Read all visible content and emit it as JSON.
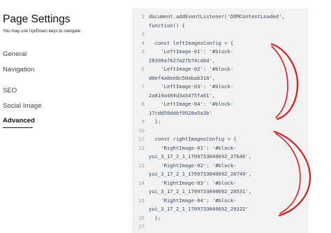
{
  "sidebar": {
    "title": "Page Settings",
    "hint": "You may use Up/Down keys to navigate",
    "items": [
      {
        "label": "General",
        "active": false
      },
      {
        "label": "Navigation",
        "active": false
      },
      {
        "label": "SEO",
        "active": false
      },
      {
        "label": "Social Image",
        "active": false
      },
      {
        "label": "Advanced",
        "active": true
      }
    ]
  },
  "editor": {
    "lines": [
      {
        "n": "2",
        "text": "document.addEventListener('DOMContentLoaded',"
      },
      {
        "n": "",
        "text": "function() {"
      },
      {
        "n": "3",
        "text": ""
      },
      {
        "n": "4",
        "text": "  const leftImagesConfig = {"
      },
      {
        "n": "5",
        "text": "    'LeftImage-01': '#block-"
      },
      {
        "n": "",
        "text": "28399af627a27b74cd0d',"
      },
      {
        "n": "6",
        "text": "    'LeftImage-02': '#block-"
      },
      {
        "n": "",
        "text": "d0ef4a0ee8c50ebab310',"
      },
      {
        "n": "7",
        "text": "    'LeftImage-03': '#block-"
      },
      {
        "n": "",
        "text": "2a819a494d3a5475fa01',"
      },
      {
        "n": "8",
        "text": "    'LeftImage-04': '#block-"
      },
      {
        "n": "",
        "text": "17cdd50ddbf9928a5a3b'"
      },
      {
        "n": "9",
        "text": "  };"
      },
      {
        "n": "10",
        "text": ""
      },
      {
        "n": "11",
        "text": "  const rightImagesConfig = {"
      },
      {
        "n": "12",
        "text": "    'RightImage-01': '#block-"
      },
      {
        "n": "",
        "text": "yui_3_17_2_1_1709733040692_27646',"
      },
      {
        "n": "13",
        "text": "    'RightImage-02': '#block-"
      },
      {
        "n": "",
        "text": "yui_3_17_2_1_1709733040692_26749',"
      },
      {
        "n": "14",
        "text": "    'RightImage-03': '#block-"
      },
      {
        "n": "",
        "text": "yui_3_17_2_1_1709733040692_28531',"
      },
      {
        "n": "15",
        "text": "    'RightImage-04': '#block-"
      },
      {
        "n": "",
        "text": "yui_3_17_2_1_1709733040692_29322'"
      },
      {
        "n": "16",
        "text": "  };"
      },
      {
        "n": "17",
        "text": ""
      }
    ]
  },
  "colors": {
    "annotation": "#e0191f",
    "editor_bg": "#f2f2f3"
  }
}
